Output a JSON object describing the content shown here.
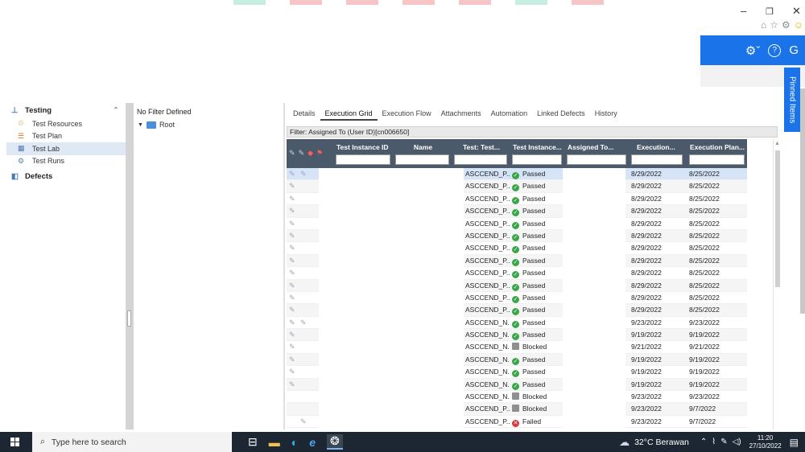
{
  "window": {
    "minimize": "–",
    "restore": "❐",
    "close": "✕",
    "browser_icons": [
      "⌂",
      "☆",
      "⚙",
      "☺"
    ]
  },
  "header": {
    "settings_icon": "⚙ˇ",
    "help_icon": "?",
    "logout_icon": "G",
    "pinned_label": "Pinned Items"
  },
  "sidebar": {
    "section_testing": "Testing",
    "items": [
      {
        "label": "Test Resources"
      },
      {
        "label": "Test Plan"
      },
      {
        "label": "Test Lab"
      },
      {
        "label": "Test Runs"
      }
    ],
    "section_defects": "Defects"
  },
  "tree": {
    "filter": "No Filter Defined",
    "root": "Root"
  },
  "tabs": [
    "Details",
    "Execution Grid",
    "Execution Flow",
    "Attachments",
    "Automation",
    "Linked Defects",
    "History"
  ],
  "filter_text": "Filter: Assigned To (User ID)[cn006650]",
  "grid": {
    "columns": [
      "Test Instance ID",
      "Name",
      "Test: Test...",
      "Test Instance...",
      "Assigned To...",
      "Execution...",
      "Execution Plan..."
    ],
    "rows": [
      {
        "test": "ASCCEND_P...",
        "status": "Passed",
        "exec": "8/29/2022",
        "plan": "8/25/2022"
      },
      {
        "test": "ASCCEND_P...",
        "status": "Passed",
        "exec": "8/29/2022",
        "plan": "8/25/2022"
      },
      {
        "test": "ASCCEND_P...",
        "status": "Passed",
        "exec": "8/29/2022",
        "plan": "8/25/2022"
      },
      {
        "test": "ASCCEND_P...",
        "status": "Passed",
        "exec": "8/29/2022",
        "plan": "8/25/2022"
      },
      {
        "test": "ASCCEND_P...",
        "status": "Passed",
        "exec": "8/29/2022",
        "plan": "8/25/2022"
      },
      {
        "test": "ASCCEND_P...",
        "status": "Passed",
        "exec": "8/29/2022",
        "plan": "8/25/2022"
      },
      {
        "test": "ASCCEND_P...",
        "status": "Passed",
        "exec": "8/29/2022",
        "plan": "8/25/2022"
      },
      {
        "test": "ASCCEND_P...",
        "status": "Passed",
        "exec": "8/29/2022",
        "plan": "8/25/2022"
      },
      {
        "test": "ASCCEND_P...",
        "status": "Passed",
        "exec": "8/29/2022",
        "plan": "8/25/2022"
      },
      {
        "test": "ASCCEND_P...",
        "status": "Passed",
        "exec": "8/29/2022",
        "plan": "8/25/2022"
      },
      {
        "test": "ASCCEND_P...",
        "status": "Passed",
        "exec": "8/29/2022",
        "plan": "8/25/2022"
      },
      {
        "test": "ASCCEND_P...",
        "status": "Passed",
        "exec": "8/29/2022",
        "plan": "8/25/2022"
      },
      {
        "test": "ASCCEND_N...",
        "status": "Passed",
        "exec": "9/23/2022",
        "plan": "9/23/2022"
      },
      {
        "test": "ASCCEND_N...",
        "status": "Passed",
        "exec": "9/19/2022",
        "plan": "9/19/2022"
      },
      {
        "test": "ASCCEND_N...",
        "status": "Blocked",
        "exec": "9/21/2022",
        "plan": "9/21/2022"
      },
      {
        "test": "ASCCEND_N...",
        "status": "Passed",
        "exec": "9/19/2022",
        "plan": "9/19/2022"
      },
      {
        "test": "ASCCEND_N...",
        "status": "Passed",
        "exec": "9/19/2022",
        "plan": "9/19/2022"
      },
      {
        "test": "ASCCEND_N...",
        "status": "Passed",
        "exec": "9/19/2022",
        "plan": "9/19/2022"
      },
      {
        "test": "ASCCEND_N...",
        "status": "Blocked",
        "exec": "9/23/2022",
        "plan": "9/23/2022"
      },
      {
        "test": "ASCCEND_P...",
        "status": "Blocked",
        "exec": "9/23/2022",
        "plan": "9/7/2022"
      },
      {
        "test": "ASCCEND_P...",
        "status": "Failed",
        "exec": "9/23/2022",
        "plan": "9/7/2022"
      }
    ]
  },
  "taskbar": {
    "search_placeholder": "Type here to search",
    "weather": "32°C Berawan",
    "time": "11:20",
    "date": "27/10/2022"
  }
}
